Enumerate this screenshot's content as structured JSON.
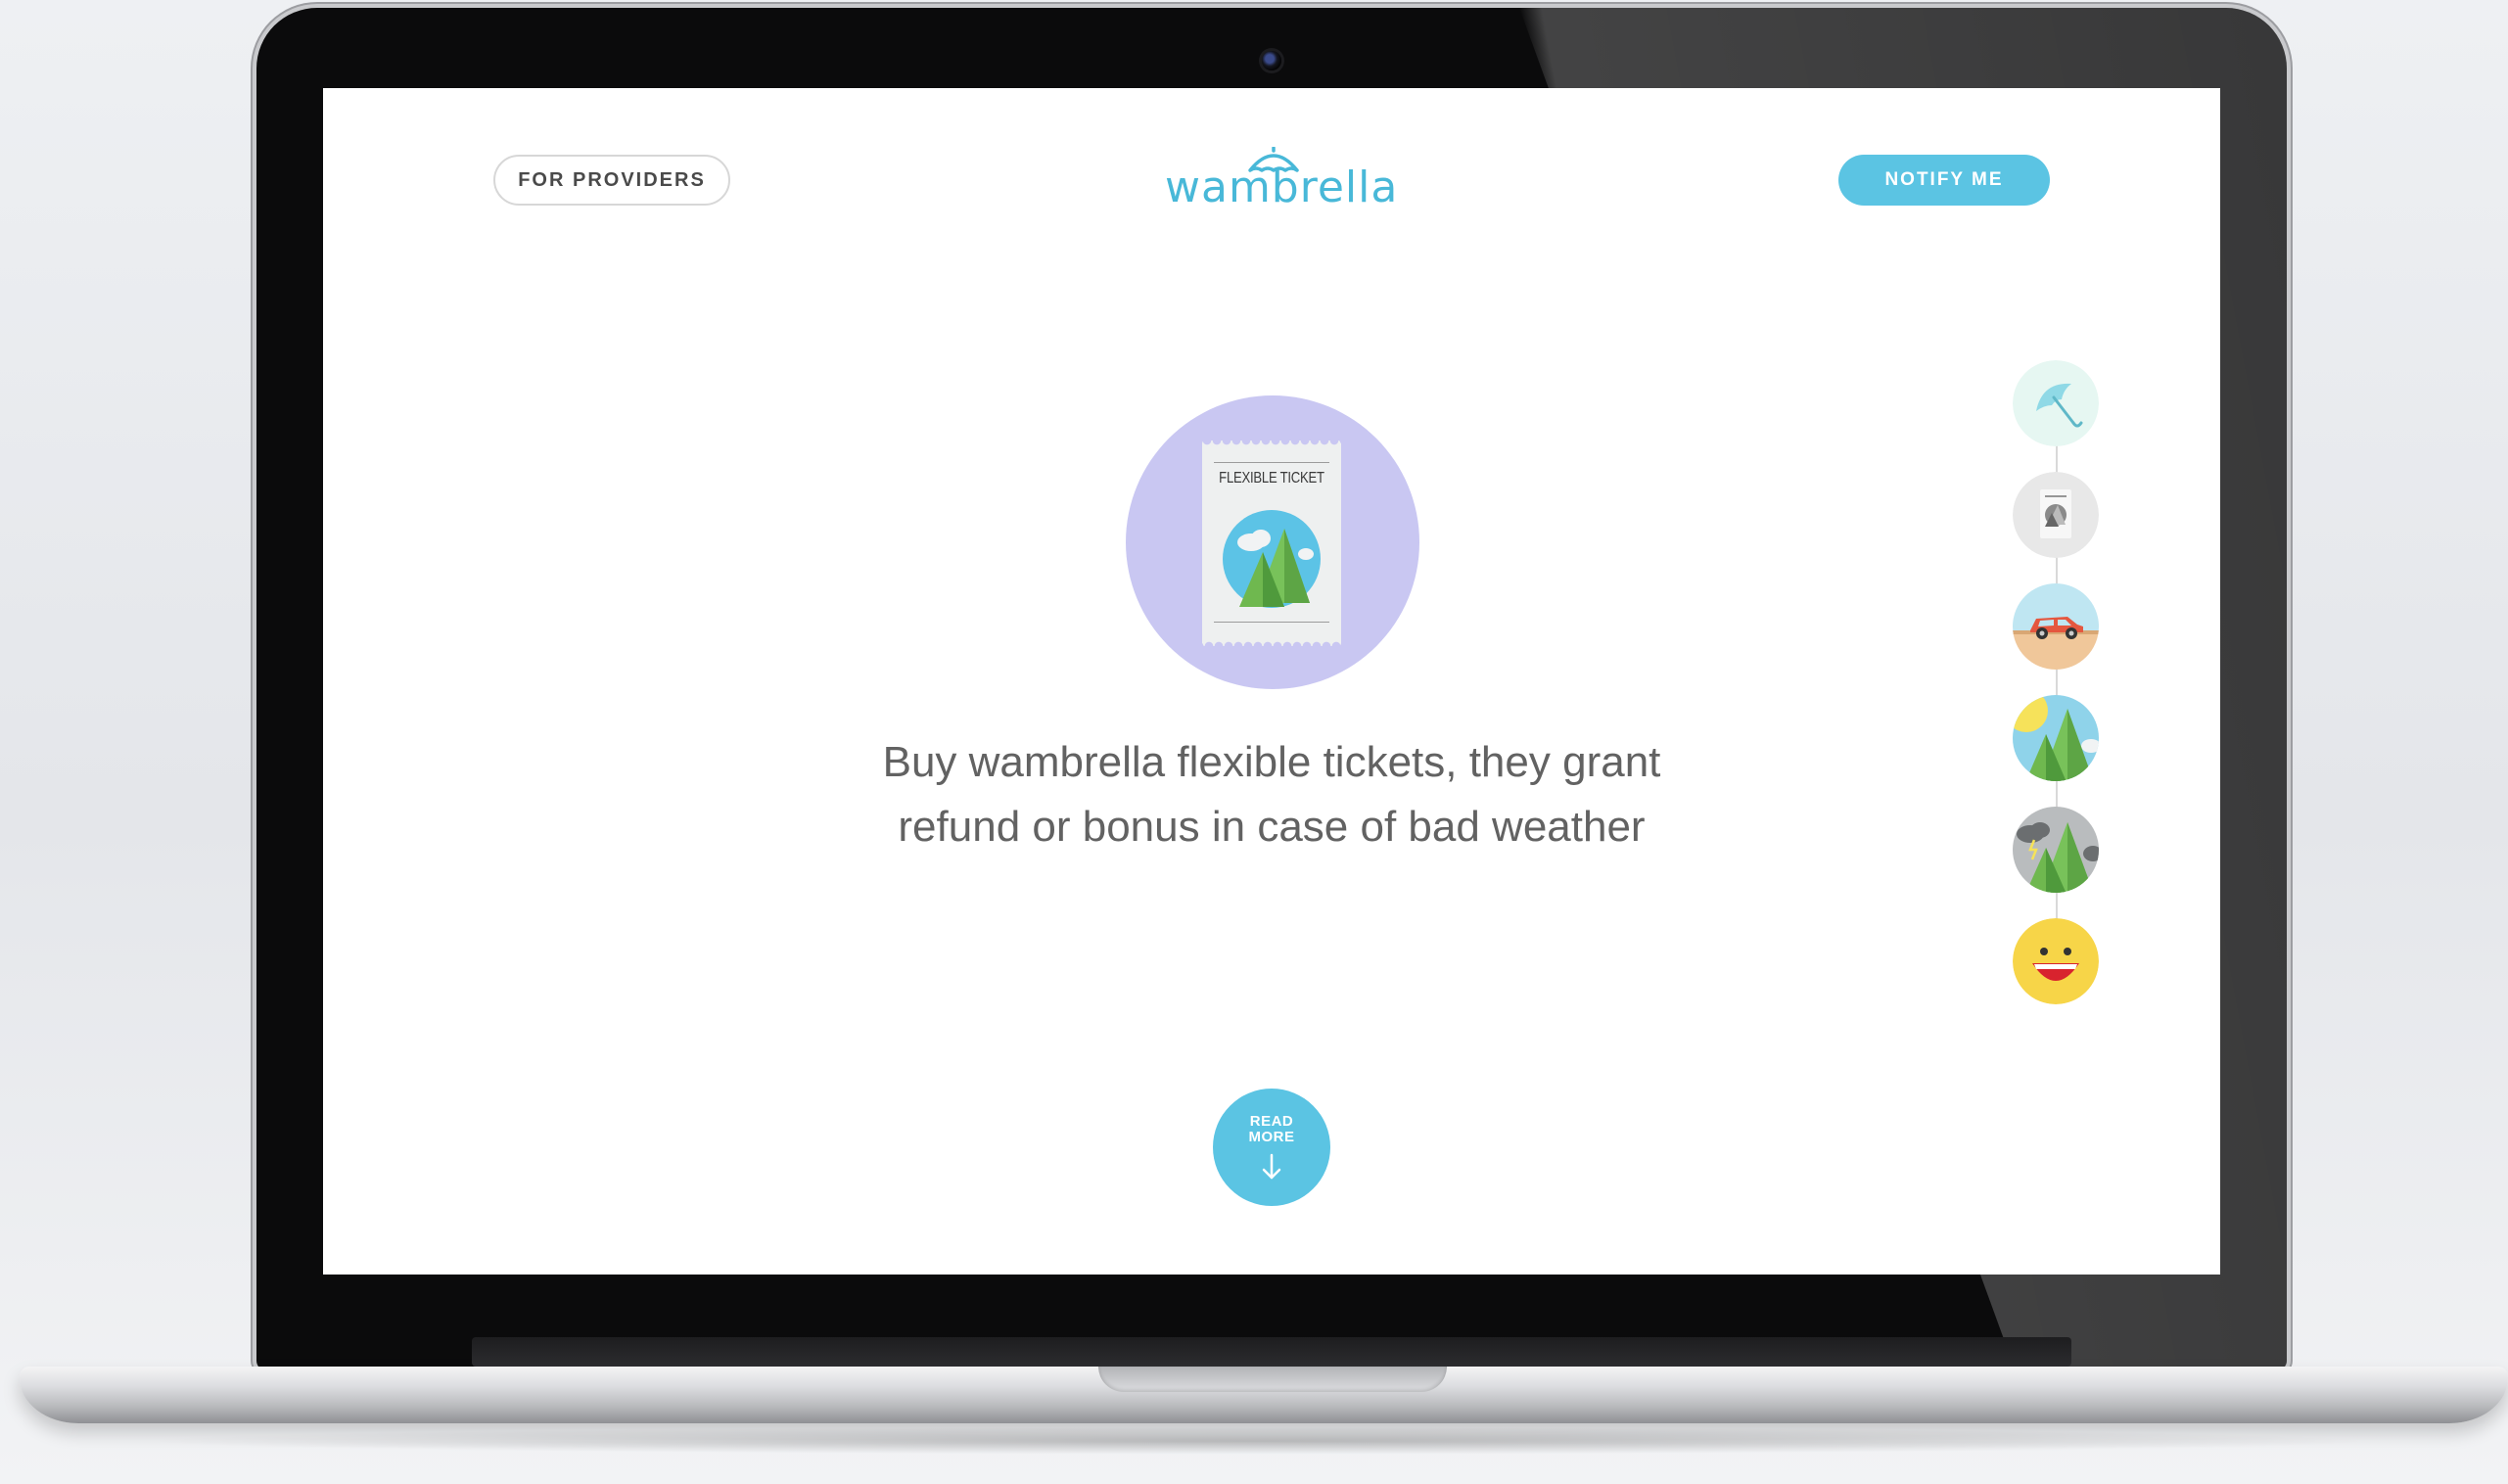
{
  "header": {
    "providers_label": "FOR PROVIDERS",
    "logo_text": "wambrella",
    "notify_label": "NOTIFY ME"
  },
  "hero": {
    "ticket_label": "FLEXIBLE TICKET",
    "tagline_line1": "Buy wambrella flexible tickets, they grant",
    "tagline_line2": "refund or bonus in case of bad weather"
  },
  "read_more": {
    "line1": "READ",
    "line2": "MORE"
  },
  "steps": [
    {
      "name": "umbrella",
      "icon": "umbrella-icon"
    },
    {
      "name": "ticket",
      "icon": "ticket-icon"
    },
    {
      "name": "car",
      "icon": "car-icon"
    },
    {
      "name": "sunny-mountains",
      "icon": "sunny-mountains-icon"
    },
    {
      "name": "stormy-mountains",
      "icon": "stormy-mountains-icon"
    },
    {
      "name": "happy-face",
      "icon": "smiley-icon"
    }
  ],
  "colors": {
    "accent": "#5bc4e3",
    "logo": "#48b8d8",
    "hero_circle": "#c9c7f2",
    "text": "#626262"
  }
}
